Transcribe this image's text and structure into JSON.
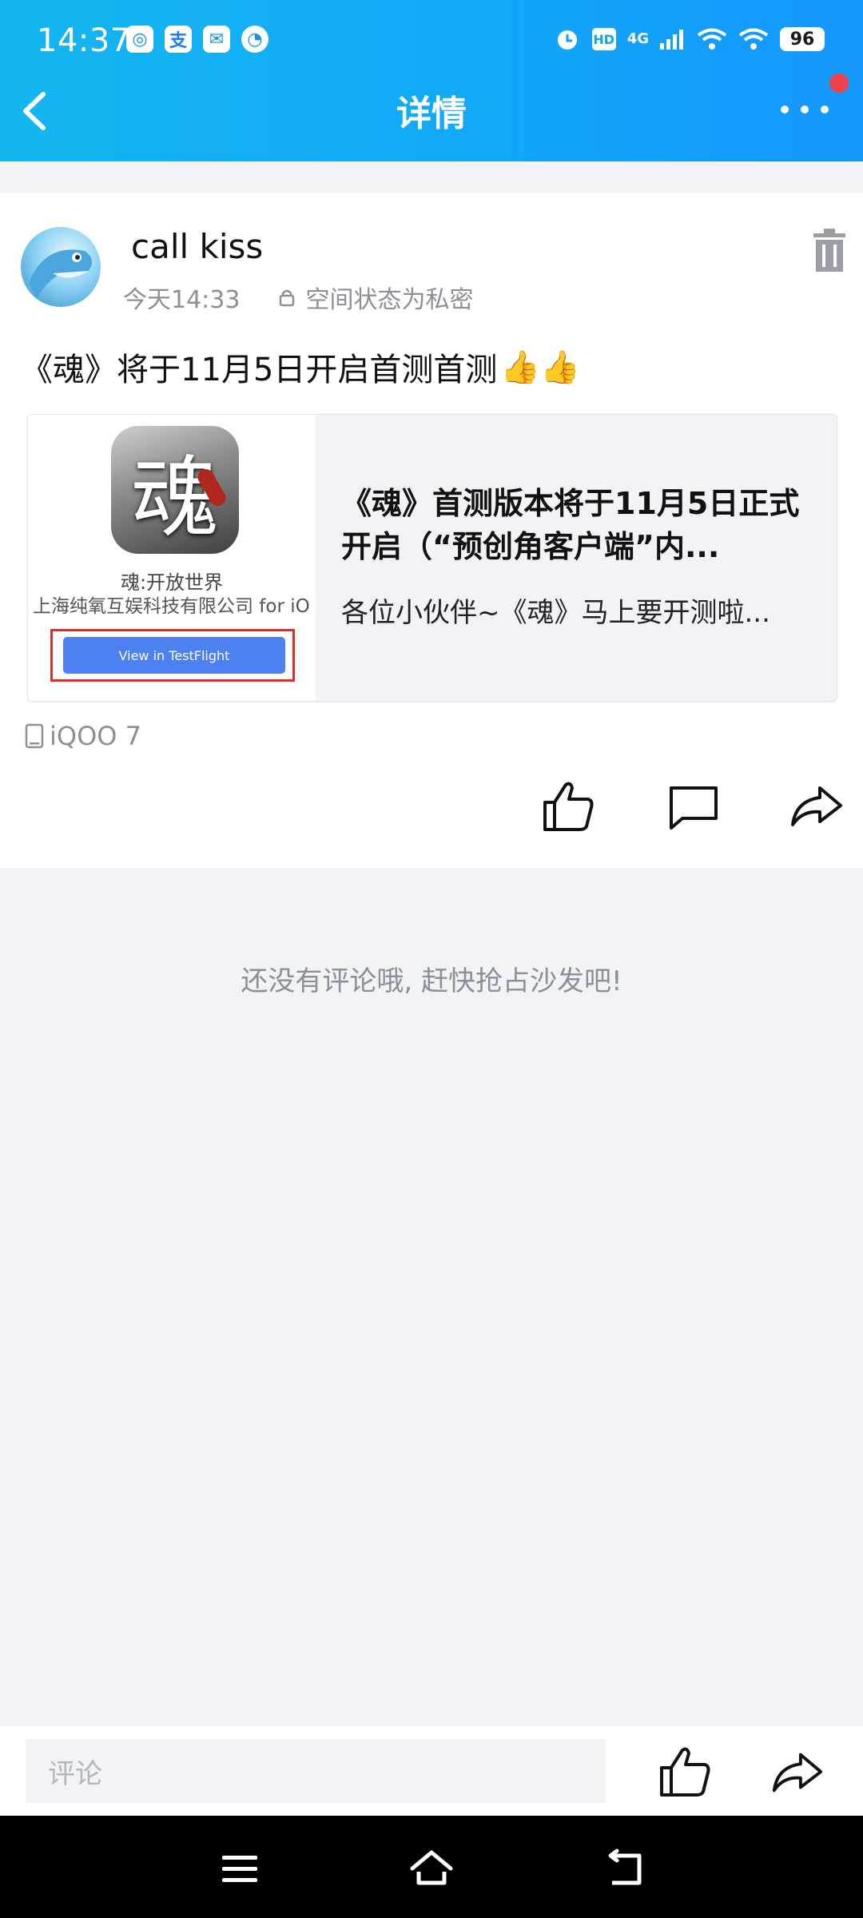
{
  "status_bar": {
    "time": "14:37",
    "app_icons": [
      "qq-browser-icon",
      "alipay-icon",
      "mail-icon",
      "speedometer-icon"
    ],
    "net": "4G",
    "hd": "HD",
    "battery": "96"
  },
  "header": {
    "title": "详情",
    "back_icon": "chevron-left-icon",
    "more_icon": "more-dots-icon",
    "accent": "#12a7f6"
  },
  "post": {
    "author": "call kiss",
    "time": "今天14:33",
    "privacy": "空间状态为私密",
    "text": "《魂》将于11月5日开启首测首测",
    "emoji": "👍👍",
    "link_card": {
      "app_glyph": "魂",
      "app_name": "魂:开放世界",
      "company": "上海纯氧互娱科技有限公司 for iO",
      "button_label": "View in TestFlight",
      "title": "《魂》首测版本将于11月5日正式开启（“预创角客户端”内...",
      "desc": "各位小伙伴~《魂》马上要开测啦..."
    },
    "device": "iQOO 7"
  },
  "comments": {
    "empty_message": "还没有评论哦, 赶快抢占沙发吧!"
  },
  "comment_bar": {
    "placeholder": "评论"
  }
}
